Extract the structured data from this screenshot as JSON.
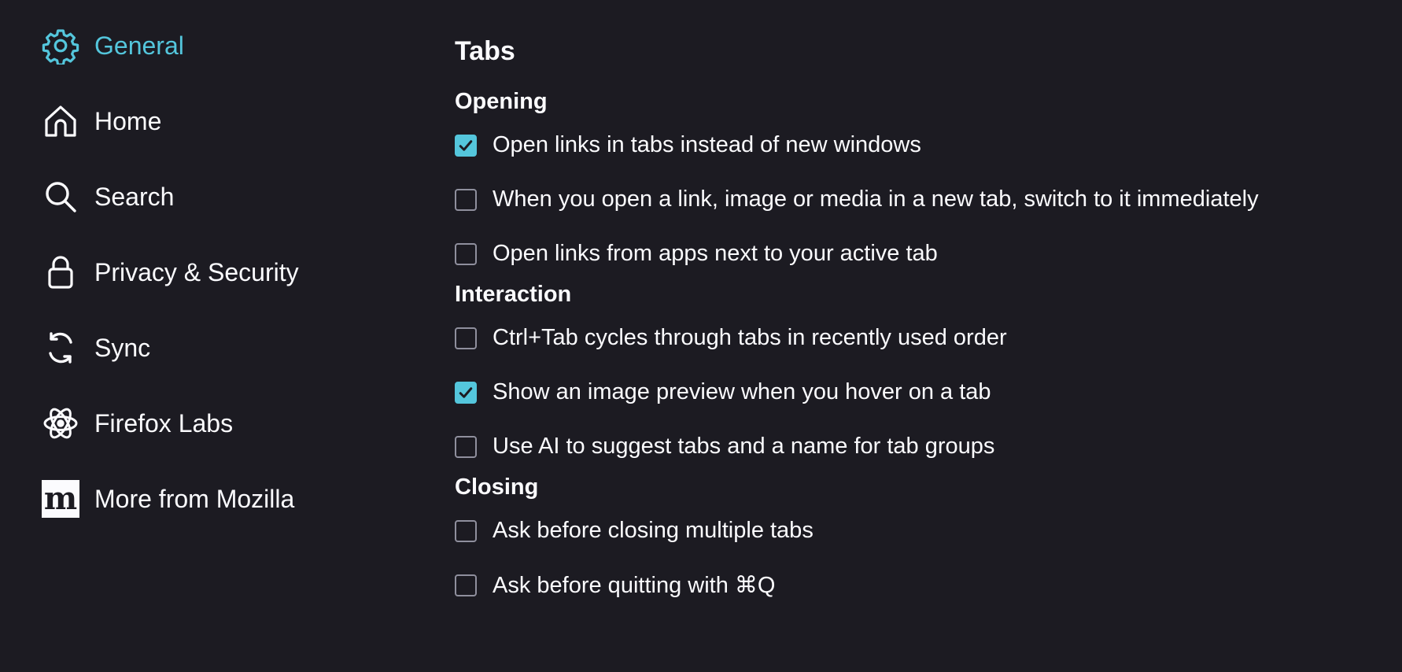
{
  "sidebar": {
    "items": [
      {
        "label": "General",
        "icon": "gear-icon",
        "selected": true
      },
      {
        "label": "Home",
        "icon": "home-icon",
        "selected": false
      },
      {
        "label": "Search",
        "icon": "search-icon",
        "selected": false
      },
      {
        "label": "Privacy & Security",
        "icon": "lock-icon",
        "selected": false
      },
      {
        "label": "Sync",
        "icon": "sync-icon",
        "selected": false
      },
      {
        "label": "Firefox Labs",
        "icon": "atom-icon",
        "selected": false
      },
      {
        "label": "More from Mozilla",
        "icon": "mozilla-logo-icon",
        "selected": false
      }
    ],
    "mozilla_logo_text": "m"
  },
  "main": {
    "title": "Tabs",
    "sections": [
      {
        "title": "Opening",
        "options": [
          {
            "label": "Open links in tabs instead of new windows",
            "checked": true
          },
          {
            "label": "When you open a link, image or media in a new tab, switch to it immediately",
            "checked": false
          },
          {
            "label": "Open links from apps next to your active tab",
            "checked": false
          }
        ]
      },
      {
        "title": "Interaction",
        "options": [
          {
            "label": "Ctrl+Tab cycles through tabs in recently used order",
            "checked": false
          },
          {
            "label": "Show an image preview when you hover on a tab",
            "checked": true
          },
          {
            "label": "Use AI to suggest tabs and a name for tab groups",
            "checked": false
          }
        ]
      },
      {
        "title": "Closing",
        "options": [
          {
            "label": "Ask before closing multiple tabs",
            "checked": false
          },
          {
            "label": "Ask before quitting with ⌘Q",
            "checked": false
          }
        ]
      }
    ]
  },
  "colors": {
    "background": "#1c1b22",
    "accent": "#54c6dc",
    "text": "#fbfbfe",
    "checkbox_border": "#8f8f9d"
  }
}
